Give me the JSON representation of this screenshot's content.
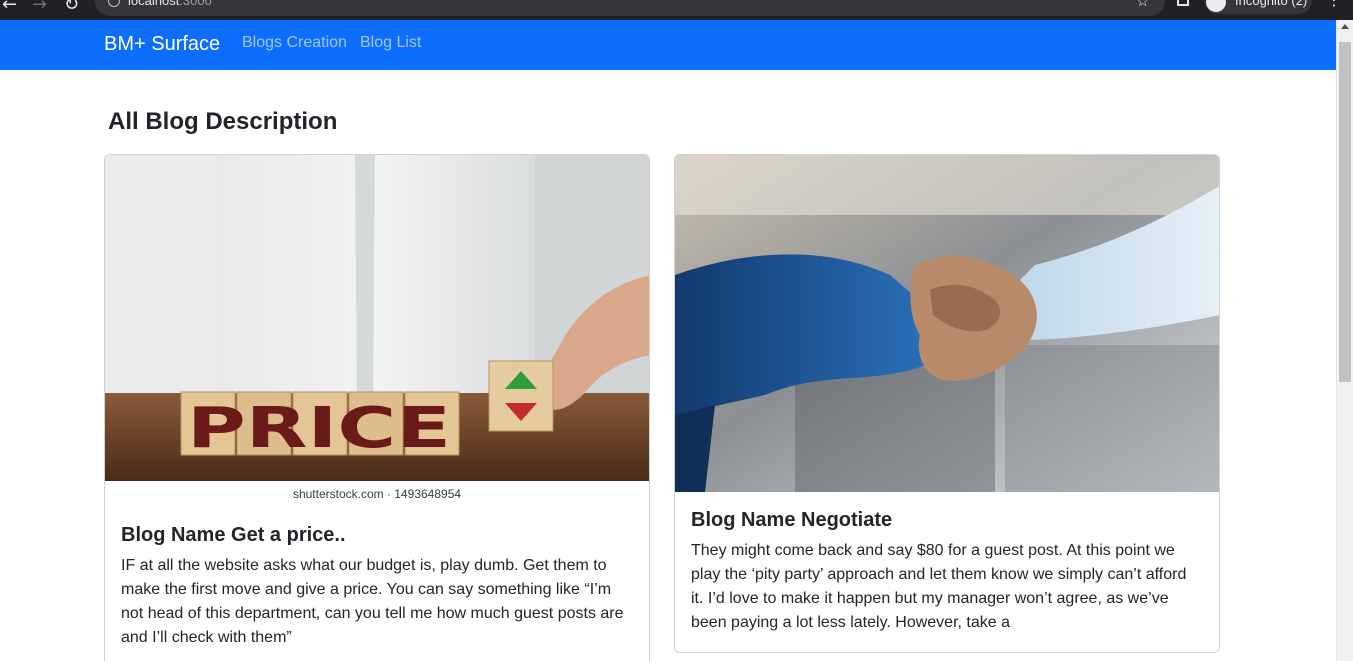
{
  "browser": {
    "url_host": "localhost",
    "url_port": ":3000",
    "incognito_label": "Incognito (2)"
  },
  "navbar": {
    "brand": "BM+ Surface",
    "links": [
      "Blogs Creation",
      "Blog List"
    ]
  },
  "page": {
    "title": "All Blog Description"
  },
  "cards": [
    {
      "title": "Blog Name Get a price..",
      "text": "IF at all the website asks what our budget is, play dumb. Get them to make the first move and give a price. You can say something like “I’m not head of this department, can you tell me how much guest posts are and I’ll check with them”",
      "image": {
        "word": "PRICE",
        "credit": "shutterstock.com · 1493648954"
      }
    },
    {
      "title": "Blog Name Negotiate",
      "text": "They might come back and say $80 for a guest post. At this point we play the ‘pity party’ approach and let them know we simply can’t afford it. I’d love to make it happen but my manager won’t agree, as we’ve been paying a lot less lately. However, take a"
    }
  ],
  "colors": {
    "navbar": "#0d6efd",
    "text": "#212529"
  }
}
